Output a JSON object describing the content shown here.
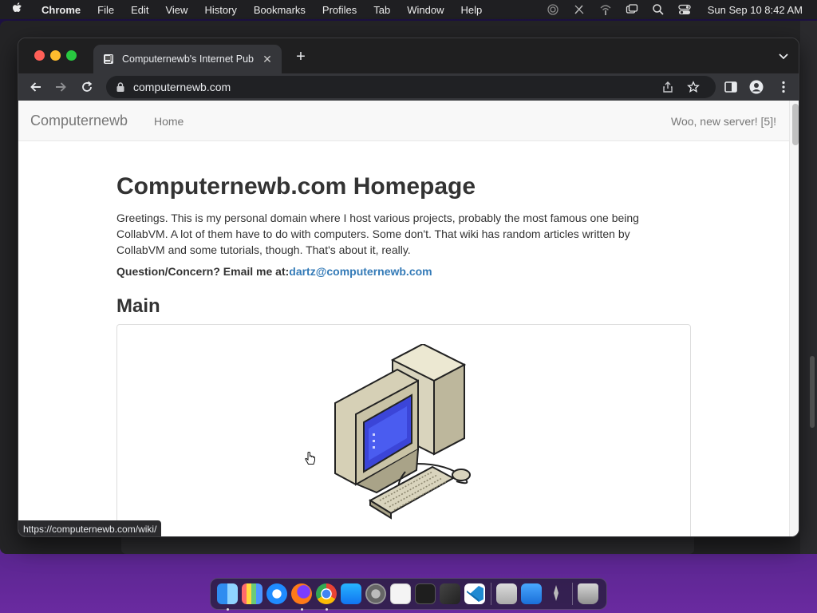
{
  "menubar": {
    "app_name": "Chrome",
    "items": [
      "File",
      "Edit",
      "View",
      "History",
      "Bookmarks",
      "Profiles",
      "Tab",
      "Window",
      "Help"
    ],
    "clock": "Sun Sep 10  8:42 AM"
  },
  "browser": {
    "tab_title": "Computernewb's Internet Pub",
    "url": "computernewb.com",
    "status_url": "https://computernewb.com/wiki/"
  },
  "page": {
    "brand": "Computernewb",
    "nav_home": "Home",
    "nav_right": "Woo, new server! [5]!",
    "heading": "Computernewb.com Homepage",
    "intro": "Greetings. This is my personal domain where I host various projects, probably the most famous one being CollabVM. A lot of them have to do with computers. Some don't. That wiki has random articles written by CollabVM and some tutorials, though. That's about it, really.",
    "contact_label": "Question/Concern? Email me at:",
    "contact_email": "dartz@computernewb.com",
    "section_heading": "Main"
  },
  "colors": {
    "link": "#337ab7",
    "navbar_bg": "#f8f8f8",
    "chrome_frame": "#35363a"
  },
  "dock": {
    "icons": [
      "finder-icon",
      "launchpad-icon",
      "safari-icon",
      "firefox-icon",
      "chrome-icon",
      "app-store-icon",
      "system-settings-icon",
      "textedit-icon",
      "terminal-icon",
      "sketch-icon",
      "vscode-icon",
      "preview-icon",
      "xcode-icon",
      "rocket-icon",
      "trash-icon"
    ]
  }
}
